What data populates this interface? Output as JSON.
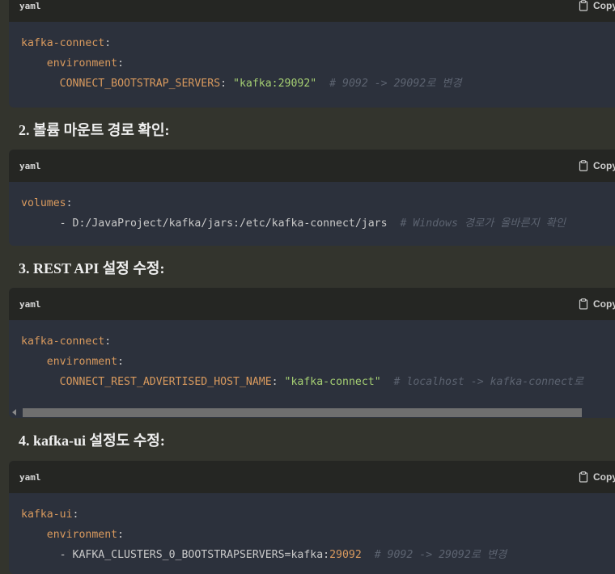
{
  "blocks": [
    {
      "lang": "yaml",
      "copy_label": "Copy",
      "lines": [
        {
          "indent": "",
          "key": "kafka-connect",
          "punct": ":"
        },
        {
          "indent": "    ",
          "key": "environment",
          "punct": ":"
        },
        {
          "indent": "      ",
          "key": "CONNECT_BOOTSTRAP_SERVERS",
          "punct": ": ",
          "string": "\"kafka:29092\"",
          "comment": "  # 9092 -> 29092로 변경"
        }
      ]
    },
    {
      "lang": "yaml",
      "copy_label": "Copy",
      "lines": [
        {
          "indent": "",
          "key": "volumes",
          "punct": ":"
        },
        {
          "indent": "      ",
          "plain": "- D:/JavaProject/kafka/jars:/etc/kafka-connect/jars",
          "comment": "  # Windows 경로가 올바른지 확인"
        }
      ]
    },
    {
      "lang": "yaml",
      "copy_label": "Copy",
      "lines": [
        {
          "indent": "",
          "key": "kafka-connect",
          "punct": ":"
        },
        {
          "indent": "    ",
          "key": "environment",
          "punct": ":"
        },
        {
          "indent": "      ",
          "key": "CONNECT_REST_ADVERTISED_HOST_NAME",
          "punct": ": ",
          "string": "\"kafka-connect\"",
          "comment": "  # localhost -> kafka-connect로"
        }
      ]
    },
    {
      "lang": "yaml",
      "copy_label": "Copy",
      "lines": [
        {
          "indent": "",
          "key": "kafka-ui",
          "punct": ":"
        },
        {
          "indent": "    ",
          "key": "environment",
          "punct": ":"
        },
        {
          "indent": "      ",
          "plain": "- KAFKA_CLUSTERS_0_BOOTSTRAPSERVERS=kafka:",
          "number": "29092",
          "comment": "  # 9092 -> 29092로 변경"
        }
      ]
    }
  ],
  "headings": [
    "2. 볼륨 마운트 경로 확인:",
    "3. REST API 설정 수정:",
    "4. kafka-ui 설정도 수정:"
  ],
  "icons": {
    "copy": "clipboard-icon",
    "scroll_left": "scroll-left-arrow-icon"
  }
}
